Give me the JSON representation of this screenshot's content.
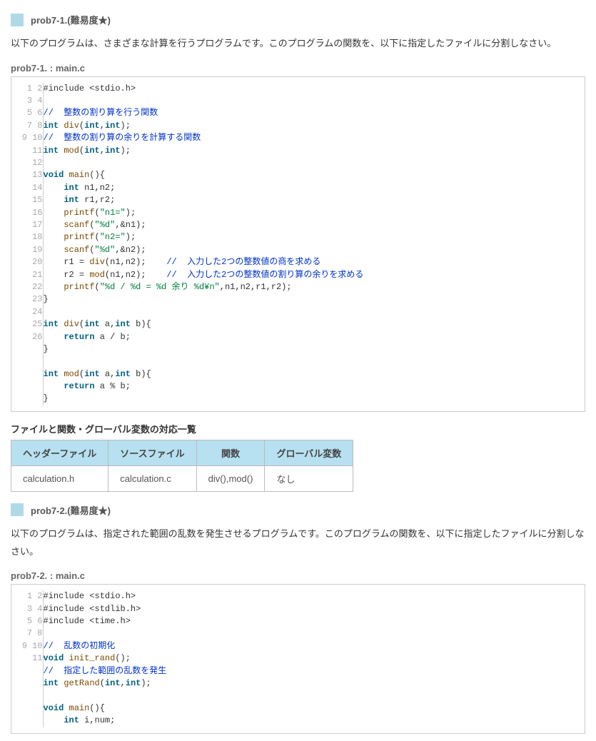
{
  "p1": {
    "title": "prob7-1.(難易度★)",
    "desc": "以下のプログラムは、さまざまな計算を行うプログラムです。このプログラムの関数を、以下に指定したファイルに分割しなさい。",
    "file": "prob7-1. : main.c",
    "code": [
      [
        {
          "t": "p",
          "v": "#include <stdio.h>"
        }
      ],
      [],
      [
        {
          "t": "c",
          "v": "//  整数の割り算を行う関数"
        }
      ],
      [
        {
          "t": "t",
          "v": "int"
        },
        {
          "t": "p",
          "v": " "
        },
        {
          "t": "f",
          "v": "div"
        },
        {
          "t": "p",
          "v": "("
        },
        {
          "t": "t",
          "v": "int"
        },
        {
          "t": "p",
          "v": ","
        },
        {
          "t": "t",
          "v": "int"
        },
        {
          "t": "p",
          "v": ");"
        }
      ],
      [
        {
          "t": "c",
          "v": "//  整数の割り算の余りを計算する関数"
        }
      ],
      [
        {
          "t": "t",
          "v": "int"
        },
        {
          "t": "p",
          "v": " "
        },
        {
          "t": "f",
          "v": "mod"
        },
        {
          "t": "p",
          "v": "("
        },
        {
          "t": "t",
          "v": "int"
        },
        {
          "t": "p",
          "v": ","
        },
        {
          "t": "t",
          "v": "int"
        },
        {
          "t": "p",
          "v": ");"
        }
      ],
      [],
      [
        {
          "t": "t",
          "v": "void"
        },
        {
          "t": "p",
          "v": " "
        },
        {
          "t": "f",
          "v": "main"
        },
        {
          "t": "p",
          "v": "(){"
        }
      ],
      [
        {
          "t": "p",
          "v": "    "
        },
        {
          "t": "t",
          "v": "int"
        },
        {
          "t": "p",
          "v": " n1,n2;"
        }
      ],
      [
        {
          "t": "p",
          "v": "    "
        },
        {
          "t": "t",
          "v": "int"
        },
        {
          "t": "p",
          "v": " r1,r2;"
        }
      ],
      [
        {
          "t": "p",
          "v": "    "
        },
        {
          "t": "f",
          "v": "printf"
        },
        {
          "t": "p",
          "v": "("
        },
        {
          "t": "s",
          "v": "\"n1=\""
        },
        {
          "t": "p",
          "v": ");"
        }
      ],
      [
        {
          "t": "p",
          "v": "    "
        },
        {
          "t": "f",
          "v": "scanf"
        },
        {
          "t": "p",
          "v": "("
        },
        {
          "t": "s",
          "v": "\"%d\""
        },
        {
          "t": "p",
          "v": ",&n1);"
        }
      ],
      [
        {
          "t": "p",
          "v": "    "
        },
        {
          "t": "f",
          "v": "printf"
        },
        {
          "t": "p",
          "v": "("
        },
        {
          "t": "s",
          "v": "\"n2=\""
        },
        {
          "t": "p",
          "v": ");"
        }
      ],
      [
        {
          "t": "p",
          "v": "    "
        },
        {
          "t": "f",
          "v": "scanf"
        },
        {
          "t": "p",
          "v": "("
        },
        {
          "t": "s",
          "v": "\"%d\""
        },
        {
          "t": "p",
          "v": ",&n2);"
        }
      ],
      [
        {
          "t": "p",
          "v": "    r1 = "
        },
        {
          "t": "f",
          "v": "div"
        },
        {
          "t": "p",
          "v": "(n1,n2);    "
        },
        {
          "t": "c",
          "v": "//  入力した2つの整数値の商を求める"
        }
      ],
      [
        {
          "t": "p",
          "v": "    r2 = "
        },
        {
          "t": "f",
          "v": "mod"
        },
        {
          "t": "p",
          "v": "(n1,n2);    "
        },
        {
          "t": "c",
          "v": "//  入力した2つの整数値の割り算の余りを求める"
        }
      ],
      [
        {
          "t": "p",
          "v": "    "
        },
        {
          "t": "f",
          "v": "printf"
        },
        {
          "t": "p",
          "v": "("
        },
        {
          "t": "s",
          "v": "\"%d / %d = %d 余り %d¥n\""
        },
        {
          "t": "p",
          "v": ",n1,n2,r1,r2);"
        }
      ],
      [
        {
          "t": "p",
          "v": "}"
        }
      ],
      [],
      [
        {
          "t": "t",
          "v": "int"
        },
        {
          "t": "p",
          "v": " "
        },
        {
          "t": "f",
          "v": "div"
        },
        {
          "t": "p",
          "v": "("
        },
        {
          "t": "t",
          "v": "int"
        },
        {
          "t": "p",
          "v": " a,"
        },
        {
          "t": "t",
          "v": "int"
        },
        {
          "t": "p",
          "v": " b){"
        }
      ],
      [
        {
          "t": "p",
          "v": "    "
        },
        {
          "t": "k",
          "v": "return"
        },
        {
          "t": "p",
          "v": " a / b;"
        }
      ],
      [
        {
          "t": "p",
          "v": "}"
        }
      ],
      [],
      [
        {
          "t": "t",
          "v": "int"
        },
        {
          "t": "p",
          "v": " "
        },
        {
          "t": "f",
          "v": "mod"
        },
        {
          "t": "p",
          "v": "("
        },
        {
          "t": "t",
          "v": "int"
        },
        {
          "t": "p",
          "v": " a,"
        },
        {
          "t": "t",
          "v": "int"
        },
        {
          "t": "p",
          "v": " b){"
        }
      ],
      [
        {
          "t": "p",
          "v": "    "
        },
        {
          "t": "k",
          "v": "return"
        },
        {
          "t": "p",
          "v": " a % b;"
        }
      ],
      [
        {
          "t": "p",
          "v": "}"
        }
      ]
    ],
    "tblcap": "ファイルと関数・グローバル変数の対応一覧",
    "th": [
      "ヘッダーファイル",
      "ソースファイル",
      "関数",
      "グローバル変数"
    ],
    "td": [
      "calculation.h",
      "calculation.c",
      "div(),mod()",
      "なし"
    ]
  },
  "p2": {
    "title": "prob7-2.(難易度★)",
    "desc": "以下のプログラムは、指定された範囲の乱数を発生させるプログラムです。このプログラムの関数を、以下に指定したファイルに分割しなさい。",
    "file": "prob7-2. : main.c",
    "code": [
      [
        {
          "t": "p",
          "v": "#include <stdio.h>"
        }
      ],
      [
        {
          "t": "p",
          "v": "#include <stdlib.h>"
        }
      ],
      [
        {
          "t": "p",
          "v": "#include <time.h>"
        }
      ],
      [],
      [
        {
          "t": "c",
          "v": "//  乱数の初期化"
        }
      ],
      [
        {
          "t": "t",
          "v": "void"
        },
        {
          "t": "p",
          "v": " "
        },
        {
          "t": "f",
          "v": "init_rand"
        },
        {
          "t": "p",
          "v": "();"
        }
      ],
      [
        {
          "t": "c",
          "v": "//  指定した範囲の乱数を発生"
        }
      ],
      [
        {
          "t": "t",
          "v": "int"
        },
        {
          "t": "p",
          "v": " "
        },
        {
          "t": "f",
          "v": "getRand"
        },
        {
          "t": "p",
          "v": "("
        },
        {
          "t": "t",
          "v": "int"
        },
        {
          "t": "p",
          "v": ","
        },
        {
          "t": "t",
          "v": "int"
        },
        {
          "t": "p",
          "v": ");"
        }
      ],
      [],
      [
        {
          "t": "t",
          "v": "void"
        },
        {
          "t": "p",
          "v": " "
        },
        {
          "t": "f",
          "v": "main"
        },
        {
          "t": "p",
          "v": "(){"
        }
      ],
      [
        {
          "t": "p",
          "v": "    "
        },
        {
          "t": "t",
          "v": "int"
        },
        {
          "t": "p",
          "v": " i,num;"
        }
      ]
    ]
  }
}
